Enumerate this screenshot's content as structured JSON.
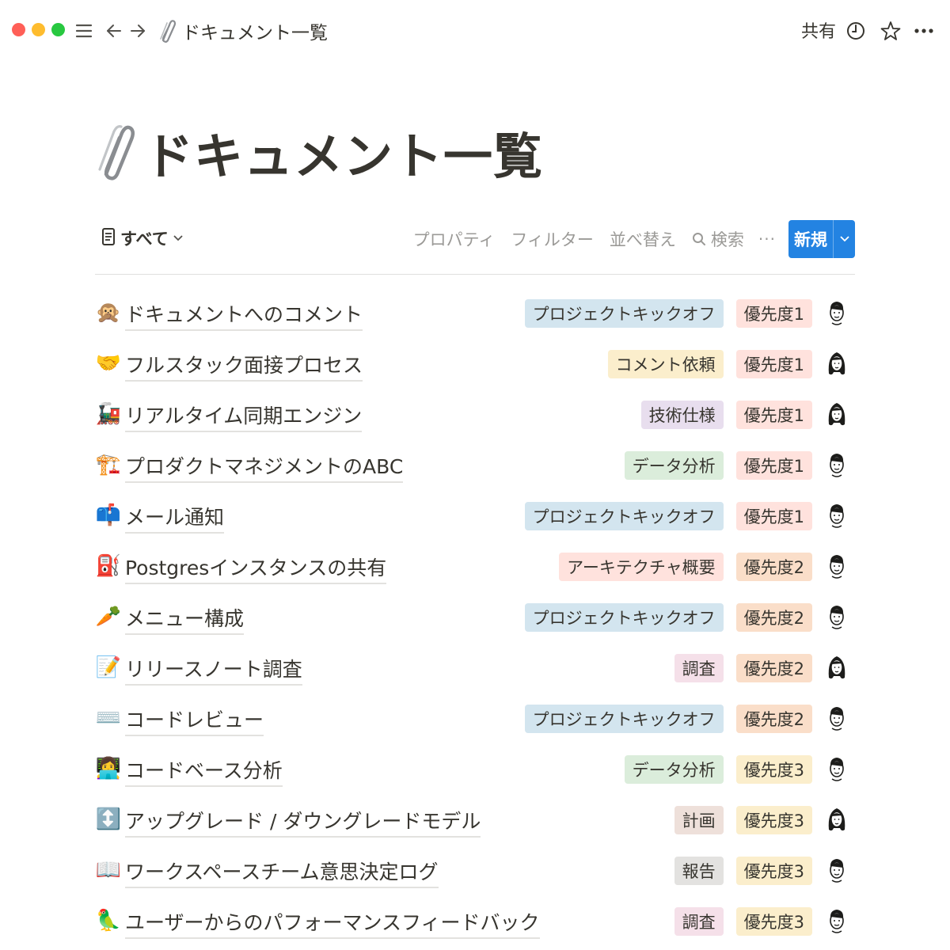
{
  "topbar": {
    "page_title": "ドキュメント一覧",
    "share_label": "共有",
    "icons": [
      "menu-icon",
      "back-arrow-icon",
      "forward-arrow-icon",
      "paperclip-icon",
      "clock-icon",
      "star-icon",
      "more-icon"
    ]
  },
  "page": {
    "title": "ドキュメント一覧",
    "title_icon": "paperclip-icon"
  },
  "view": {
    "tab_label": "すべて",
    "actions": {
      "properties": "プロパティ",
      "filter": "フィルター",
      "sort": "並べ替え",
      "search": "検索",
      "more": "···"
    },
    "new_button": "新規"
  },
  "colors": {
    "tag_blue": "#d3e5ef",
    "tag_yellow": "#fbeecc",
    "tag_purple": "#e8deee",
    "tag_green": "#dbeddb",
    "tag_red": "#ffe2dd",
    "tag_pink": "#f5e0e9",
    "tag_brown": "#eee0da",
    "tag_gray": "#e3e2e0",
    "tag_orange": "#fadec9",
    "accent": "#2383e2"
  },
  "rows": [
    {
      "emoji": "🙊",
      "title": "ドキュメントへのコメント",
      "category": "プロジェクトキックオフ",
      "category_color": "#d3e5ef",
      "priority": "優先度1",
      "priority_color": "#ffe2dd",
      "avatar": "avatar-man"
    },
    {
      "emoji": "🤝",
      "title": "フルスタック面接プロセス",
      "category": "コメント依頼",
      "category_color": "#fbeecc",
      "priority": "優先度1",
      "priority_color": "#ffe2dd",
      "avatar": "avatar-woman"
    },
    {
      "emoji": "🚂",
      "title": "リアルタイム同期エンジン",
      "category": "技術仕様",
      "category_color": "#e8deee",
      "priority": "優先度1",
      "priority_color": "#ffe2dd",
      "avatar": "avatar-woman"
    },
    {
      "emoji": "🏗️",
      "title": "プロダクトマネジメントのABC",
      "category": "データ分析",
      "category_color": "#dbeddb",
      "priority": "優先度1",
      "priority_color": "#ffe2dd",
      "avatar": "avatar-man"
    },
    {
      "emoji": "📫",
      "title": "メール通知",
      "category": "プロジェクトキックオフ",
      "category_color": "#d3e5ef",
      "priority": "優先度1",
      "priority_color": "#ffe2dd",
      "avatar": "avatar-man"
    },
    {
      "emoji": "⛽",
      "title": "Postgresインスタンスの共有",
      "category": "アーキテクチャ概要",
      "category_color": "#ffe2dd",
      "priority": "優先度2",
      "priority_color": "#fadec9",
      "avatar": "avatar-man"
    },
    {
      "emoji": "🥕",
      "title": "メニュー構成",
      "category": "プロジェクトキックオフ",
      "category_color": "#d3e5ef",
      "priority": "優先度2",
      "priority_color": "#fadec9",
      "avatar": "avatar-man"
    },
    {
      "emoji": "📝",
      "title": "リリースノート調査",
      "category": "調査",
      "category_color": "#f5e0e9",
      "priority": "優先度2",
      "priority_color": "#fadec9",
      "avatar": "avatar-woman"
    },
    {
      "emoji": "⌨️",
      "title": "コードレビュー",
      "category": "プロジェクトキックオフ",
      "category_color": "#d3e5ef",
      "priority": "優先度2",
      "priority_color": "#fadec9",
      "avatar": "avatar-man"
    },
    {
      "emoji": "👩‍💻",
      "title": "コードベース分析",
      "category": "データ分析",
      "category_color": "#dbeddb",
      "priority": "優先度3",
      "priority_color": "#fbeecc",
      "avatar": "avatar-man"
    },
    {
      "emoji": "↕️",
      "title": "アップグレード / ダウングレードモデル",
      "category": "計画",
      "category_color": "#eee0da",
      "priority": "優先度3",
      "priority_color": "#fbeecc",
      "avatar": "avatar-woman"
    },
    {
      "emoji": "📖",
      "title": "ワークスペースチーム意思決定ログ",
      "category": "報告",
      "category_color": "#e3e2e0",
      "priority": "優先度3",
      "priority_color": "#fbeecc",
      "avatar": "avatar-man"
    },
    {
      "emoji": "🦜",
      "title": "ユーザーからのパフォーマンスフィードバック",
      "category": "調査",
      "category_color": "#f5e0e9",
      "priority": "優先度3",
      "priority_color": "#fbeecc",
      "avatar": "avatar-man"
    }
  ]
}
